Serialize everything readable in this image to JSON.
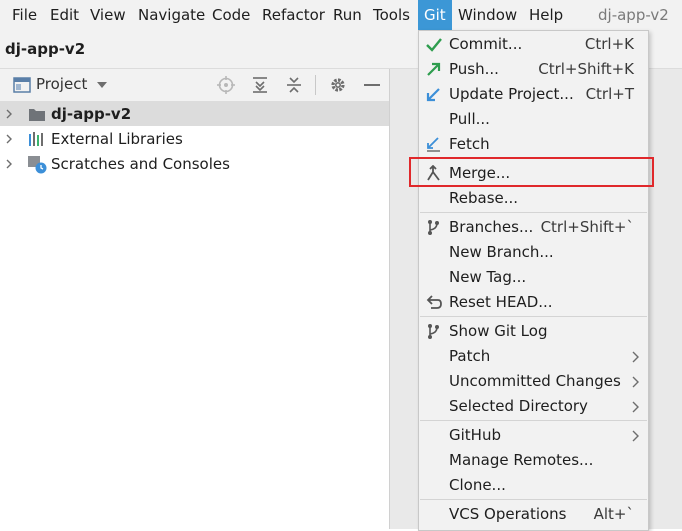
{
  "menubar": {
    "items": [
      "File",
      "Edit",
      "View",
      "Navigate",
      "Code",
      "Refactor",
      "Run",
      "Tools",
      "Git",
      "Window",
      "Help"
    ],
    "active": "Git",
    "project_title": "dj-app-v2"
  },
  "navbar": {
    "breadcrumb": "dj-app-v2"
  },
  "project_panel": {
    "title": "Project",
    "tree": [
      {
        "label": "dj-app-v2",
        "icon": "folder-icon",
        "selected": true
      },
      {
        "label": "External Libraries",
        "icon": "library-icon",
        "selected": false
      },
      {
        "label": "Scratches and Consoles",
        "icon": "scratches-icon",
        "selected": false
      }
    ]
  },
  "git_menu": {
    "items": [
      {
        "label": "Commit...",
        "shortcut": "Ctrl+K",
        "icon": "check-icon"
      },
      {
        "label": "Push...",
        "shortcut": "Ctrl+Shift+K",
        "icon": "push-arrow-icon"
      },
      {
        "label": "Update Project...",
        "shortcut": "Ctrl+T",
        "icon": "update-arrow-icon"
      },
      {
        "label": "Pull...",
        "shortcut": ""
      },
      {
        "label": "Fetch",
        "shortcut": "",
        "icon": "fetch-icon"
      },
      {
        "label": "Merge...",
        "shortcut": "",
        "icon": "merge-icon"
      },
      {
        "label": "Rebase...",
        "shortcut": ""
      },
      {
        "label": "Branches...",
        "shortcut": "Ctrl+Shift+`",
        "icon": "branch-icon"
      },
      {
        "label": "New Branch...",
        "shortcut": ""
      },
      {
        "label": "New Tag...",
        "shortcut": ""
      },
      {
        "label": "Reset HEAD...",
        "shortcut": "",
        "icon": "reset-icon"
      },
      {
        "label": "Show Git Log",
        "shortcut": "",
        "icon": "git-log-icon"
      },
      {
        "label": "Patch",
        "shortcut": "",
        "submenu": true
      },
      {
        "label": "Uncommitted Changes",
        "shortcut": "",
        "submenu": true
      },
      {
        "label": "Selected Directory",
        "shortcut": "",
        "submenu": true
      },
      {
        "label": "GitHub",
        "shortcut": "",
        "submenu": true
      },
      {
        "label": "Manage Remotes...",
        "shortcut": ""
      },
      {
        "label": "Clone...",
        "shortcut": ""
      },
      {
        "label": "VCS Operations",
        "shortcut": "Alt+`"
      }
    ]
  },
  "colors": {
    "menu_active": "#3c97d6",
    "highlight_box": "#e0282b",
    "check_green": "#2e9d4e",
    "arrow_blue": "#3c8fd8"
  }
}
